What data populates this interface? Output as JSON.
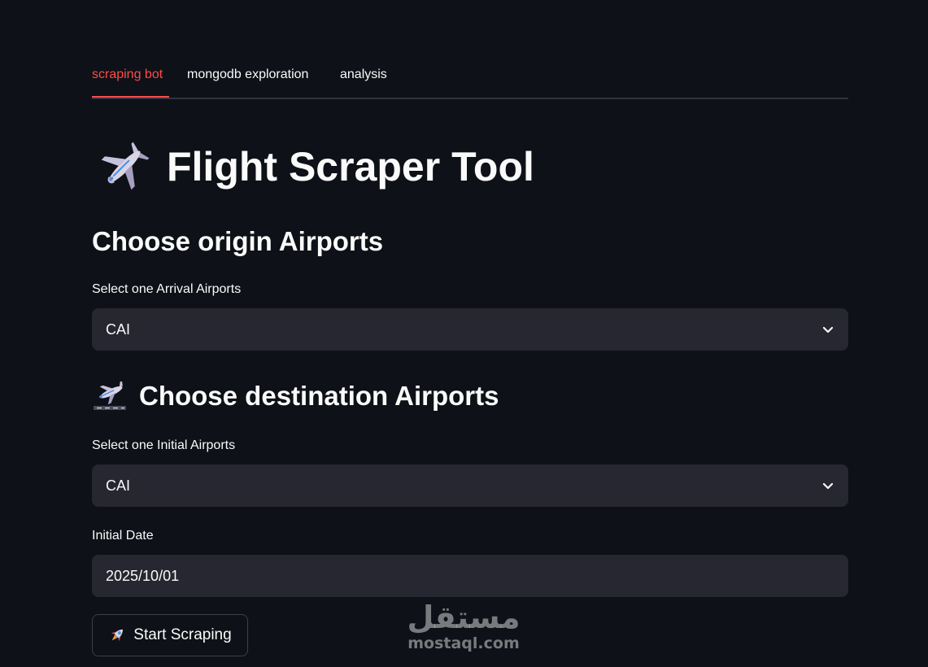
{
  "tabs": [
    {
      "label": "scraping bot",
      "active": true
    },
    {
      "label": "mongodb exploration",
      "active": false
    },
    {
      "label": "analysis",
      "active": false
    }
  ],
  "title": {
    "icon": "airplane-icon",
    "text": "Flight Scraper Tool"
  },
  "origin": {
    "heading": "Choose origin Airports",
    "select_label": "Select one Arrival Airports",
    "selected_value": "CAI"
  },
  "destination": {
    "heading_icon": "airplane-arrival-icon",
    "heading": "Choose destination Airports",
    "select_label": "Select one Initial Airports",
    "selected_value": "CAI"
  },
  "date": {
    "label": "Initial Date",
    "value": "2025/10/01"
  },
  "button": {
    "icon": "rocket-icon",
    "label": "Start Scraping"
  },
  "watermark": {
    "arabic": "مستقل",
    "latin": "mostaql.com"
  },
  "colors": {
    "background": "#0e1117",
    "accent": "#ff4b4b",
    "field": "#262730",
    "text": "#fafafa"
  }
}
